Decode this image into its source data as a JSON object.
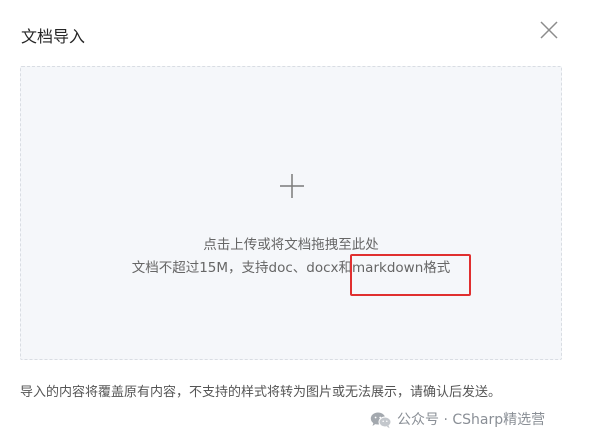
{
  "dialog": {
    "title": "文档导入",
    "close_icon": "close-icon"
  },
  "dropzone": {
    "icon": "plus-icon",
    "line1": "点击上传或将文档拖拽至此处",
    "line2": "文档不超过15M，支持doc、docx和markdown格式"
  },
  "footer": {
    "note": "导入的内容将覆盖原有内容，不支持的样式将转为图片或无法展示，请确认后发送。"
  },
  "watermark": {
    "text": "公众号 · CSharp精选营",
    "icon": "wechat-icon"
  },
  "colors": {
    "highlight": "#e02f2f",
    "dropzone_bg": "#f5f7fa",
    "dropzone_border": "#d9dde3"
  }
}
